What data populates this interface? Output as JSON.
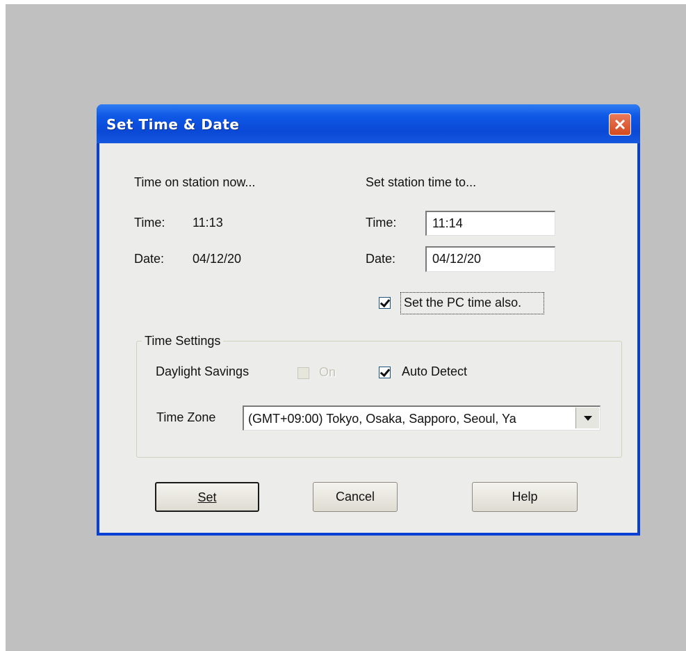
{
  "dialog": {
    "title": "Set Time & Date",
    "close_icon": "close-x-icon"
  },
  "current": {
    "heading": "Time on station now...",
    "time_label": "Time:",
    "time_value": "11:13",
    "date_label": "Date:",
    "date_value": "04/12/20"
  },
  "set_to": {
    "heading": "Set station time to...",
    "time_label": "Time:",
    "time_value": "11:14",
    "date_label": "Date:",
    "date_value": "04/12/20",
    "pc_time_label": "Set the PC time also.",
    "pc_time_checked": true
  },
  "time_settings": {
    "group_title": "Time Settings",
    "daylight_label": "Daylight Savings",
    "daylight_on_label": "On",
    "daylight_on_checked": false,
    "daylight_on_enabled": false,
    "auto_detect_label": "Auto Detect",
    "auto_detect_checked": true,
    "timezone_label": "Time Zone",
    "timezone_value": "(GMT+09:00) Tokyo, Osaka, Sapporo, Seoul, Ya"
  },
  "buttons": {
    "set_label": "Set",
    "cancel_label": "Cancel",
    "help_label": "Help"
  },
  "colors": {
    "title_bar": "#0a49d6",
    "close_button": "#d44a1e",
    "dialog_face": "#ececea",
    "desktop": "#c0c0c0"
  }
}
